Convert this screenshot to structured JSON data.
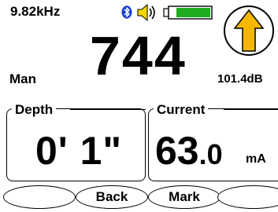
{
  "status": {
    "frequency": "9.82kHz",
    "icons": [
      "bluetooth-icon",
      "speaker-icon",
      "battery-icon"
    ],
    "battery_level": 0.8
  },
  "main": {
    "signal_value": "744",
    "mode": "Man",
    "signal_db": "101.4dB",
    "direction_icon": "up-arrow-icon"
  },
  "depth": {
    "title": "Depth",
    "value": "0' 1\""
  },
  "current": {
    "title": "Current",
    "value_int": "63",
    "value_dec": ".0",
    "unit": "mA"
  },
  "softkeys": {
    "key1": "",
    "key2": "Back",
    "key3": "Mark",
    "key4": ""
  },
  "colors": {
    "bluetooth": "#1a3fd6",
    "speaker": "#f2d800",
    "battery": "#1fae1f",
    "arrow": "#f5b800"
  }
}
